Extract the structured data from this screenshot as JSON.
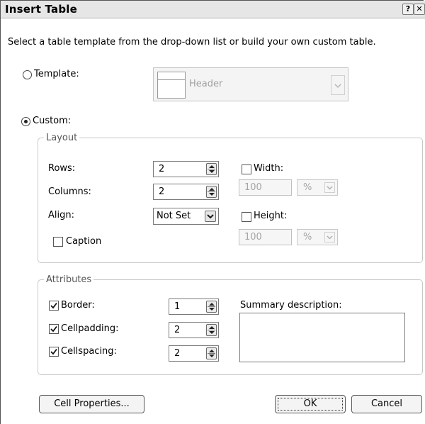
{
  "window": {
    "title": "Insert Table",
    "help_glyph": "?",
    "close_glyph": "✕"
  },
  "intro_text": "Select a table template from the drop-down list or build your own custom table.",
  "template": {
    "label": "Template:",
    "selected": false,
    "preview_label": "Header"
  },
  "custom": {
    "label": "Custom:",
    "selected": true
  },
  "layout": {
    "legend": "Layout",
    "rows_label": "Rows:",
    "rows_value": "2",
    "columns_label": "Columns:",
    "columns_value": "2",
    "align_label": "Align:",
    "align_value": "Not Set",
    "caption_label": "Caption",
    "caption_checked": false,
    "width_label": "Width:",
    "width_checked": false,
    "width_value": "100",
    "width_unit": "%",
    "height_label": "Height:",
    "height_checked": false,
    "height_value": "100",
    "height_unit": "%"
  },
  "attributes": {
    "legend": "Attributes",
    "border_label": "Border:",
    "border_checked": true,
    "border_value": "1",
    "cellpadding_label": "Cellpadding:",
    "cellpadding_checked": true,
    "cellpadding_value": "2",
    "cellspacing_label": "Cellspacing:",
    "cellspacing_checked": true,
    "cellspacing_value": "2",
    "summary_label": "Summary description:",
    "summary_value": ""
  },
  "buttons": {
    "cell_properties": "Cell Properties...",
    "ok": "OK",
    "cancel": "Cancel"
  },
  "icons": {
    "help": "help-icon",
    "close": "close-icon",
    "check": "check-icon",
    "spin": "spinner-arrows-icon",
    "dropdown": "chevron-down-icon"
  }
}
